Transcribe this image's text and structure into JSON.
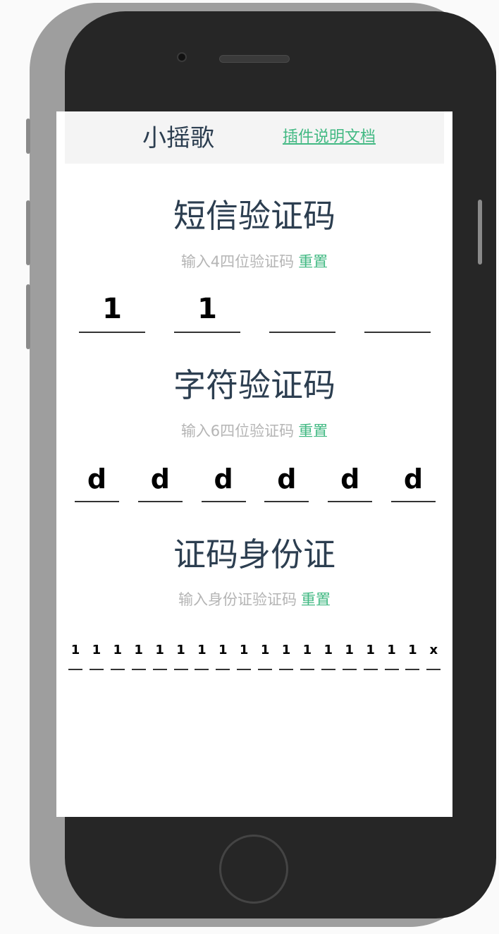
{
  "header": {
    "brand": "小摇歌",
    "doc_link": "插件说明文档"
  },
  "sms": {
    "title": "短信验证码",
    "hint": "输入4四位验证码",
    "reset": "重置",
    "values": [
      "1",
      "1",
      "",
      ""
    ]
  },
  "char": {
    "title": "字符验证码",
    "hint": "输入6四位验证码",
    "reset": "重置",
    "values": [
      "d",
      "d",
      "d",
      "d",
      "d",
      "d"
    ]
  },
  "idcard": {
    "title": "证码身份证",
    "hint": "输入身份证验证码",
    "reset": "重置",
    "values": [
      "1",
      "1",
      "1",
      "1",
      "1",
      "1",
      "1",
      "1",
      "1",
      "1",
      "1",
      "1",
      "1",
      "1",
      "1",
      "1",
      "1",
      "x"
    ]
  },
  "colors": {
    "accent": "#42b983",
    "title": "#2c3e50",
    "hint": "#b5b5b5",
    "phone_body": "#262626"
  },
  "icons": {
    "camera": "camera-icon",
    "speaker": "speaker-icon",
    "home": "home-button-icon"
  }
}
